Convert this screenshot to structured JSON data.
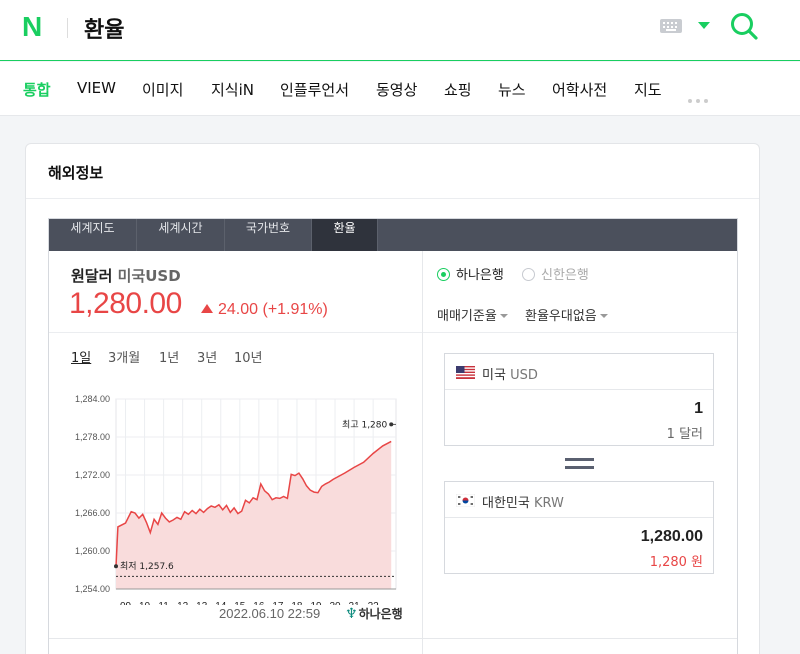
{
  "header": {
    "logo": "N",
    "query": "환율"
  },
  "nav": {
    "items": [
      "통합",
      "VIEW",
      "이미지",
      "지식iN",
      "인플루언서",
      "동영상",
      "쇼핑",
      "뉴스",
      "어학사전",
      "지도"
    ],
    "active": "통합"
  },
  "card": {
    "title": "해외정보"
  },
  "tabs": [
    "세계지도",
    "세계시간",
    "국가번호",
    "환율"
  ],
  "active_tab": "환율",
  "rate": {
    "pair_main": "원달러",
    "pair_sub": "미국USD",
    "value": "1,280.00",
    "change": "24.00 (+1.91%)"
  },
  "periods": [
    "1일",
    "3개월",
    "1년",
    "3년",
    "10년"
  ],
  "active_period": "1일",
  "chart_data": {
    "type": "area",
    "ylim": [
      1254,
      1284
    ],
    "y_ticks": [
      "1,284.00",
      "1,278.00",
      "1,272.00",
      "1,266.00",
      "1,260.00",
      "1,254.00"
    ],
    "x_ticks": [
      "09",
      "10",
      "11",
      "12",
      "13",
      "14",
      "15",
      "16",
      "17",
      "18",
      "19",
      "20",
      "21",
      "22"
    ],
    "x": [
      8.5,
      8.6,
      9.0,
      9.3,
      9.5,
      9.7,
      9.9,
      10.1,
      10.3,
      10.5,
      10.7,
      10.9,
      11.1,
      11.3,
      11.5,
      11.7,
      11.9,
      12.1,
      12.3,
      12.5,
      12.7,
      12.9,
      13.1,
      13.3,
      13.5,
      13.7,
      13.9,
      14.1,
      14.3,
      14.5,
      14.7,
      14.9,
      15.1,
      15.3,
      15.5,
      15.7,
      15.9,
      16.1,
      16.3,
      16.5,
      16.7,
      16.9,
      17.1,
      17.3,
      17.5,
      17.7,
      17.9,
      18.1,
      18.3,
      18.5,
      18.7,
      18.9,
      19.1,
      19.3,
      19.5,
      19.7,
      19.9,
      20.5,
      21.0,
      21.5,
      22.0,
      22.5,
      22.95
    ],
    "values": [
      1257.6,
      1263.8,
      1264.4,
      1266.2,
      1266.0,
      1265.2,
      1265.8,
      1264.5,
      1262.9,
      1265.0,
      1264.2,
      1266.0,
      1265.2,
      1264.6,
      1264.9,
      1265.3,
      1265.0,
      1266.2,
      1265.8,
      1266.4,
      1265.9,
      1266.6,
      1266.1,
      1266.7,
      1267.1,
      1266.9,
      1267.3,
      1266.5,
      1267.2,
      1266.1,
      1266.8,
      1265.9,
      1266.3,
      1268.0,
      1267.6,
      1268.4,
      1268.1,
      1270.6,
      1269.5,
      1269.0,
      1268.1,
      1268.4,
      1268.3,
      1268.6,
      1268.3,
      1272.1,
      1271.9,
      1272.3,
      1271.4,
      1270.3,
      1269.6,
      1269.3,
      1269.2,
      1270.2,
      1270.6,
      1270.9,
      1271.3,
      1272.3,
      1273.2,
      1274.0,
      1275.4,
      1276.6,
      1277.3,
      1279.9
    ],
    "max_label": "최고 1,280",
    "min_label": "최저 1,257.6",
    "min_value": 1257.6,
    "max_value": 1280,
    "baseline_value": 1256,
    "colors": {
      "line": "#e84646",
      "fill": "#f9dcdc",
      "baseline": "#333333"
    }
  },
  "timestamp": "2022.06.10 22:59",
  "source_bank": "하나은행",
  "banks": [
    {
      "label": "하나은행",
      "selected": true
    },
    {
      "label": "신한은행",
      "selected": false
    }
  ],
  "dropdowns": [
    "매매기준율",
    "환율우대없음"
  ],
  "converter": {
    "from": {
      "name": "미국",
      "code": "USD",
      "amount": "1",
      "sub": "1 달러"
    },
    "to": {
      "name": "대한민국",
      "code": "KRW",
      "amount": "1,280.00",
      "sub": "1,280 원"
    }
  },
  "colors": {
    "brand": "#19ce60",
    "up": "#e84646",
    "tab_bg": "#4b505c",
    "tab_active": "#2f333c"
  }
}
